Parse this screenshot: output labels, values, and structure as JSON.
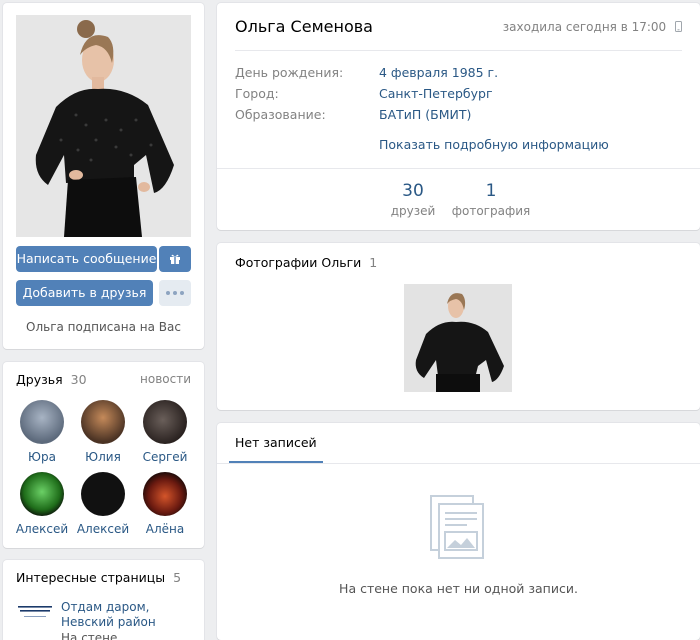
{
  "profile": {
    "message_button": "Написать сообщение",
    "add_friend_button": "Добавить в друзья",
    "subscribed_text": "Ольга подписана на Вас",
    "name": "Ольга Семенова",
    "last_seen": "заходила сегодня в 17:00",
    "info": [
      {
        "key": "День рождения:",
        "value": "4 февраля 1985 г."
      },
      {
        "key": "Город:",
        "value": "Санкт-Петербург"
      },
      {
        "key": "Образование:",
        "value": "БАТиП (БМИТ)"
      }
    ],
    "more_info_link": "Показать подробную информацию",
    "counters": [
      {
        "num": "30",
        "label": "друзей"
      },
      {
        "num": "1",
        "label": "фотография"
      }
    ]
  },
  "friends": {
    "title": "Друзья",
    "count": "30",
    "news_link": "новости",
    "items": [
      {
        "name": "Юра"
      },
      {
        "name": "Юлия"
      },
      {
        "name": "Сергей"
      },
      {
        "name": "Алексей"
      },
      {
        "name": "Алексей"
      },
      {
        "name": "Алёна"
      }
    ]
  },
  "interesting": {
    "title": "Интересные страницы",
    "count": "5",
    "page_name": "Отдам даром, Невский район",
    "page_desc": "На стене размещаются",
    "page_logo_text": "ОТДАМ ДАРОМ НЕВСКИЙ РАЙОН"
  },
  "photos": {
    "title": "Фотографии Ольги",
    "count": "1"
  },
  "wall": {
    "tab": "Нет записей",
    "empty_text": "На стене пока нет ни одной записи."
  },
  "colors": {
    "accent": "#5181b8",
    "link": "#2a5885",
    "background": "#edeef0"
  }
}
